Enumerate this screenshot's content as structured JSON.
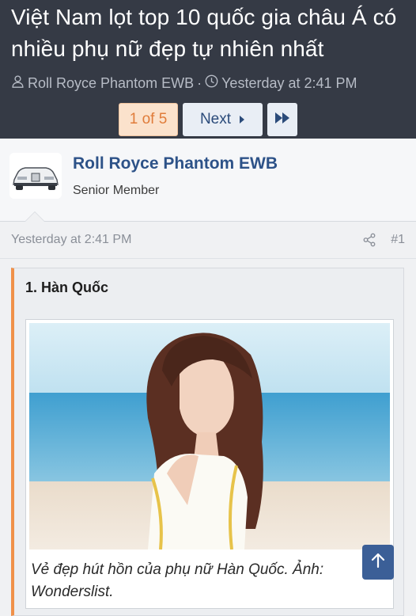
{
  "thread": {
    "title": "Việt Nam lọt top 10 quốc gia châu Á có nhiều phụ nữ đẹp tự nhiên nhất",
    "author": "Roll Royce Phantom EWB",
    "separator": "·",
    "time": "Yesterday at 2:41 PM"
  },
  "pagination": {
    "current": "1 of 5",
    "next_label": "Next"
  },
  "post": {
    "username": "Roll Royce Phantom EWB",
    "user_title": "Senior Member",
    "timestamp": "Yesterday at 2:41 PM",
    "post_number": "#1",
    "heading": "1. Hàn Quốc",
    "caption": "Vẻ đẹp hút hồn của phụ nữ Hàn Quốc. Ảnh: Wonderslist."
  },
  "colors": {
    "header_bg": "#353a45",
    "accent_orange": "#f0914a",
    "link_blue": "#2d5288"
  },
  "icons": [
    "user-icon",
    "clock-icon",
    "chevron-right-icon",
    "double-chevron-icon",
    "share-icon",
    "arrow-up-icon"
  ]
}
